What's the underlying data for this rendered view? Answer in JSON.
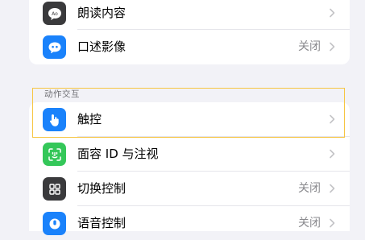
{
  "colors": {
    "accent_blue": "#1a82fb",
    "green": "#34c759",
    "gray_dark": "#3a3a3c",
    "highlight": "#f6c542"
  },
  "rows_top": [
    {
      "label": "朗读内容",
      "value": "",
      "icon": "speech-bubble-icon"
    },
    {
      "label": "口述影像",
      "value": "关闭",
      "icon": "quote-bubble-icon"
    }
  ],
  "section": {
    "header": "动作交互"
  },
  "rows_bottom": [
    {
      "label": "触控",
      "value": "",
      "icon": "hand-touch-icon"
    },
    {
      "label": "面容 ID 与注视",
      "value": "",
      "icon": "face-id-icon"
    },
    {
      "label": "切换控制",
      "value": "关闭",
      "icon": "switch-control-icon"
    },
    {
      "label": "语音控制",
      "value": "关闭",
      "icon": "voice-control-icon"
    }
  ]
}
